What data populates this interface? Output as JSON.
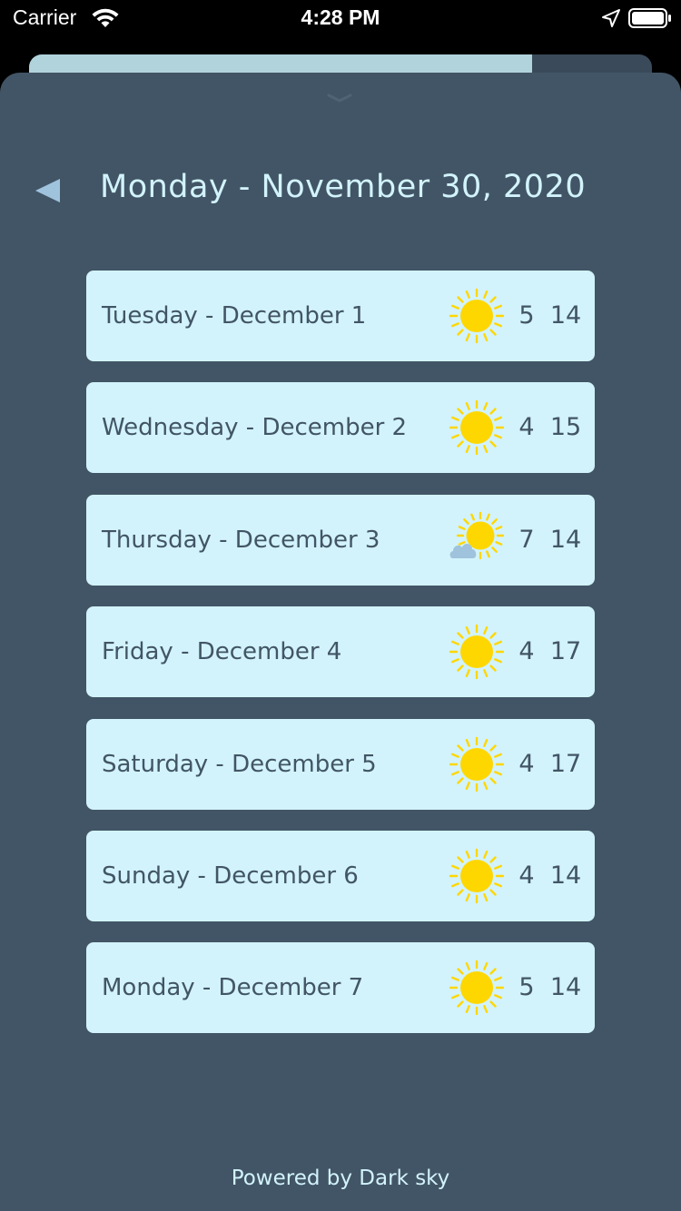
{
  "status_bar": {
    "carrier": "Carrier",
    "time": "4:28 PM"
  },
  "header": {
    "title": "Monday - November 30, 2020"
  },
  "forecast": [
    {
      "label": "Tuesday - December 1",
      "icon": "sun-icon",
      "low": "5",
      "high": "14"
    },
    {
      "label": "Wednesday - December 2",
      "icon": "sun-icon",
      "low": "4",
      "high": "15"
    },
    {
      "label": "Thursday - December 3",
      "icon": "partly-cloudy-icon",
      "low": "7",
      "high": "14"
    },
    {
      "label": "Friday - December 4",
      "icon": "sun-icon",
      "low": "4",
      "high": "17"
    },
    {
      "label": "Saturday - December 5",
      "icon": "sun-icon",
      "low": "4",
      "high": "17"
    },
    {
      "label": "Sunday - December 6",
      "icon": "sun-icon",
      "low": "4",
      "high": "14"
    },
    {
      "label": "Monday - December 7",
      "icon": "sun-icon",
      "low": "5",
      "high": "14"
    }
  ],
  "footer": {
    "text": "Powered by Dark sky"
  },
  "colors": {
    "sheet_background": "#425566",
    "row_background": "#d2f3fb",
    "title_text": "#d2f3fb",
    "row_text": "#425566",
    "sun": "#ffd700",
    "cloud": "#9fc3dc",
    "back_arrow": "#9fc3dc"
  }
}
